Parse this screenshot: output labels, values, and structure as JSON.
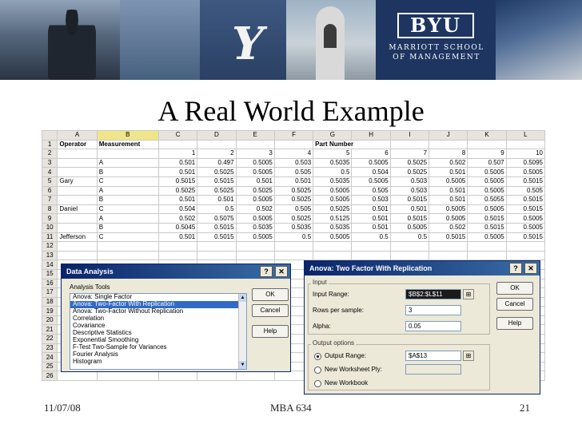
{
  "banner": {
    "school_name": "BYU",
    "school_subtitle": "MARRIOTT SCHOOL OF MANAGEMENT",
    "y_mark": "Y"
  },
  "slide": {
    "title": "A Real World Example"
  },
  "sheet": {
    "columns": [
      "A",
      "B",
      "C",
      "D",
      "E",
      "F",
      "G",
      "H",
      "I",
      "J",
      "K",
      "L"
    ],
    "row1": {
      "operator": "Operator",
      "measurement": "Measurement",
      "part_number": "Part Number"
    },
    "row2": [
      "1",
      "2",
      "3",
      "4",
      "5",
      "6",
      "7",
      "8",
      "9",
      "10"
    ],
    "rows": [
      {
        "n": "3",
        "op": "",
        "m": "A",
        "v": [
          "0.501",
          "0.497",
          "0.5005",
          "0.503",
          "0.5035",
          "0.5005",
          "0.5025",
          "0.502",
          "0.507",
          "0.5095"
        ]
      },
      {
        "n": "4",
        "op": "",
        "m": "B",
        "v": [
          "0.501",
          "0.5025",
          "0.5005",
          "0.505",
          "0.5",
          "0.504",
          "0.5025",
          "0.501",
          "0.5005",
          "0.5005"
        ]
      },
      {
        "n": "5",
        "op": "Gary",
        "m": "C",
        "v": [
          "0.5015",
          "0.5015",
          "0.501",
          "0.501",
          "0.5035",
          "0.5005",
          "0.503",
          "0.5005",
          "0.5005",
          "0.5015"
        ]
      },
      {
        "n": "6",
        "op": "",
        "m": "A",
        "v": [
          "0.5025",
          "0.5025",
          "0.5025",
          "0.5025",
          "0.5005",
          "0.505",
          "0.503",
          "0.501",
          "0.5005",
          "0.505"
        ]
      },
      {
        "n": "7",
        "op": "",
        "m": "B",
        "v": [
          "0.501",
          "0.501",
          "0.5005",
          "0.5025",
          "0.5005",
          "0.503",
          "0.5015",
          "0.501",
          "0.5055",
          "0.5015"
        ]
      },
      {
        "n": "8",
        "op": "Daniel",
        "m": "C",
        "v": [
          "0.504",
          "0.5",
          "0.502",
          "0.505",
          "0.5025",
          "0.501",
          "0.501",
          "0.5005",
          "0.5005",
          "0.5015"
        ]
      },
      {
        "n": "9",
        "op": "",
        "m": "A",
        "v": [
          "0.502",
          "0.5075",
          "0.5005",
          "0.5025",
          "0.5125",
          "0.501",
          "0.5015",
          "0.5005",
          "0.5015",
          "0.5005"
        ]
      },
      {
        "n": "10",
        "op": "",
        "m": "B",
        "v": [
          "0.5045",
          "0.5015",
          "0.5035",
          "0.5035",
          "0.5035",
          "0.501",
          "0.5005",
          "0.502",
          "0.5015",
          "0.5005"
        ]
      },
      {
        "n": "11",
        "op": "Jefferson",
        "m": "C",
        "v": [
          "0.501",
          "0.5015",
          "0.5005",
          "0.5",
          "0.5005",
          "0.5",
          "0.5",
          "0.5015",
          "0.5005",
          "0.5015"
        ]
      }
    ],
    "empty_rows": [
      "12",
      "13",
      "14",
      "15",
      "16",
      "17",
      "18",
      "19",
      "20",
      "21",
      "22",
      "23",
      "24",
      "25",
      "26"
    ]
  },
  "data_analysis": {
    "title": "Data Analysis",
    "help_icon": "question-icon",
    "close_icon": "close-icon",
    "tools_label": "Analysis Tools",
    "tools": [
      "Anova: Single Factor",
      "Anova: Two-Factor With Replication",
      "Anova: Two-Factor Without Replication",
      "Correlation",
      "Covariance",
      "Descriptive Statistics",
      "Exponential Smoothing",
      "F-Test Two-Sample for Variances",
      "Fourier Analysis",
      "Histogram"
    ],
    "selected_index": 1,
    "ok": "OK",
    "cancel": "Cancel",
    "help": "Help"
  },
  "anova_dialog": {
    "title": "Anova: Two Factor With Replication",
    "input_group": "Input",
    "input_range_label": "Input Range:",
    "input_range_value": "$B$2:$L$11",
    "rows_per_sample_label": "Rows per sample:",
    "rows_per_sample_value": "3",
    "alpha_label": "Alpha:",
    "alpha_value": "0.05",
    "output_group": "Output options",
    "output_range_label": "Output Range:",
    "output_range_value": "$A$13",
    "new_ply_label": "New Worksheet Ply:",
    "new_workbook_label": "New Workbook",
    "selected_output": "output_range",
    "ok": "OK",
    "cancel": "Cancel",
    "help": "Help"
  },
  "footer": {
    "date": "11/07/08",
    "course": "MBA 634",
    "page": "21"
  }
}
